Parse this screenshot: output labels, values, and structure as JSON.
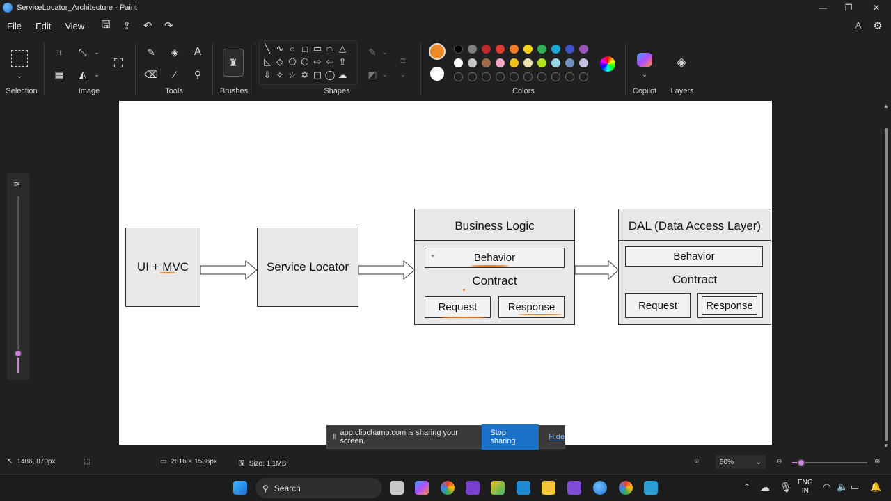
{
  "window": {
    "title": "ServiceLocator_Architecture - Paint",
    "minimize": "—",
    "maximize": "❐",
    "close": "✕"
  },
  "menu": {
    "file": "File",
    "edit": "Edit",
    "view": "View"
  },
  "ribbon": {
    "groups": {
      "selection": "Selection",
      "image": "Image",
      "tools": "Tools",
      "brushes": "Brushes",
      "shapes": "Shapes",
      "colors": "Colors",
      "copilot": "Copilot",
      "layers": "Layers"
    },
    "active_color_primary": "#f08a28",
    "active_color_secondary": "#ffffff",
    "palette_row1": [
      "#000000",
      "#7f7f7f",
      "#c0282d",
      "#e03c31",
      "#f07c2a",
      "#f5d31c",
      "#2fae55",
      "#1fa6d8",
      "#3f52c4",
      "#9b55b8"
    ],
    "palette_row2": [
      "#ffffff",
      "#c3c3c3",
      "#a06a4a",
      "#f4a6c7",
      "#f4c21e",
      "#efe4b0",
      "#b5e61d",
      "#99d9ea",
      "#7092be",
      "#c8bfe7"
    ]
  },
  "diagram": {
    "ui_mvc": "UI + MVC",
    "service_locator": "Service Locator",
    "business_logic": {
      "title": "Business Logic",
      "behavior": "Behavior",
      "contract": "Contract",
      "request": "Request",
      "response": "Response"
    },
    "dal": {
      "title": "DAL (Data Access Layer)",
      "behavior": "Behavior",
      "contract": "Contract",
      "request": "Request",
      "response": "Response"
    }
  },
  "sharing": {
    "message": "app.clipchamp.com is sharing your screen.",
    "stop": "Stop sharing",
    "hide": "Hide"
  },
  "status": {
    "cursor_pos": "1486, 870px",
    "canvas_size": "2816 × 1536px",
    "file_size": "Size: 1.1MB",
    "zoom": "50%"
  },
  "taskbar": {
    "search": "Search",
    "lang_line1": "ENG",
    "lang_line2": "IN"
  }
}
